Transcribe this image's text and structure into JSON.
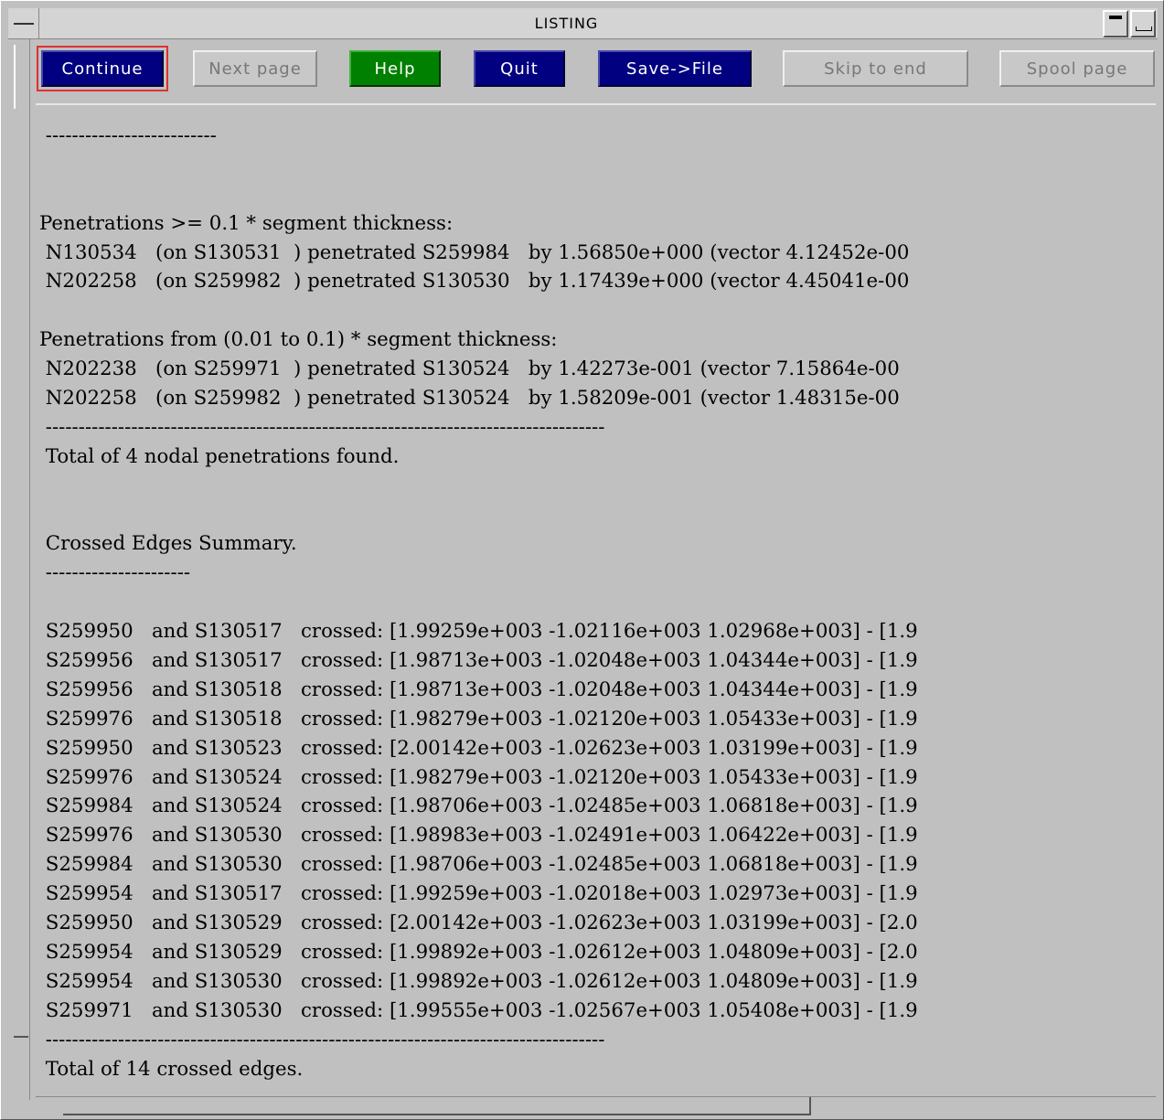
{
  "window": {
    "title": "LISTING"
  },
  "toolbar": {
    "buttons": [
      {
        "label": "Continue",
        "style": "navy",
        "enabled": true,
        "focused": true
      },
      {
        "label": "Next page",
        "style": "disabled",
        "enabled": false
      },
      {
        "label": "Help",
        "style": "green",
        "enabled": true
      },
      {
        "label": "Quit",
        "style": "navy",
        "enabled": true
      },
      {
        "label": "Save->File",
        "style": "navy",
        "enabled": true
      },
      {
        "label": "Skip to end",
        "style": "disabled",
        "enabled": false
      },
      {
        "label": "Spool page",
        "style": "disabled",
        "enabled": false
      }
    ]
  },
  "listing": {
    "lines": [
      " --------------------------",
      "",
      "",
      "Penetrations >= 0.1 * segment thickness:",
      " N130534   (on S130531  ) penetrated S259984   by 1.56850e+000 (vector 4.12452e-00",
      " N202258   (on S259982  ) penetrated S130530   by 1.17439e+000 (vector 4.45041e-00",
      "",
      "Penetrations from (0.01 to 0.1) * segment thickness:",
      " N202238   (on S259971  ) penetrated S130524   by 1.42273e-001 (vector 7.15864e-00",
      " N202258   (on S259982  ) penetrated S130524   by 1.58209e-001 (vector 1.48315e-00",
      " -------------------------------------------------------------------------------------",
      " Total of 4 nodal penetrations found.",
      "",
      "",
      " Crossed Edges Summary.",
      " ----------------------",
      "",
      " S259950   and S130517   crossed: [1.99259e+003 -1.02116e+003 1.02968e+003] - [1.9",
      " S259956   and S130517   crossed: [1.98713e+003 -1.02048e+003 1.04344e+003] - [1.9",
      " S259956   and S130518   crossed: [1.98713e+003 -1.02048e+003 1.04344e+003] - [1.9",
      " S259976   and S130518   crossed: [1.98279e+003 -1.02120e+003 1.05433e+003] - [1.9",
      " S259950   and S130523   crossed: [2.00142e+003 -1.02623e+003 1.03199e+003] - [1.9",
      " S259976   and S130524   crossed: [1.98279e+003 -1.02120e+003 1.05433e+003] - [1.9",
      " S259984   and S130524   crossed: [1.98706e+003 -1.02485e+003 1.06818e+003] - [1.9",
      " S259976   and S130530   crossed: [1.98983e+003 -1.02491e+003 1.06422e+003] - [1.9",
      " S259984   and S130530   crossed: [1.98706e+003 -1.02485e+003 1.06818e+003] - [1.9",
      " S259954   and S130517   crossed: [1.99259e+003 -1.02018e+003 1.02973e+003] - [1.9",
      " S259950   and S130529   crossed: [2.00142e+003 -1.02623e+003 1.03199e+003] - [2.0",
      " S259954   and S130529   crossed: [1.99892e+003 -1.02612e+003 1.04809e+003] - [2.0",
      " S259954   and S130530   crossed: [1.99892e+003 -1.02612e+003 1.04809e+003] - [1.9",
      " S259971   and S130530   crossed: [1.99555e+003 -1.02567e+003 1.05408e+003] - [1.9",
      " -------------------------------------------------------------------------------------",
      " Total of 14 crossed edges."
    ]
  },
  "colors": {
    "background": "#c0c0c0",
    "button_navy": "#000080",
    "button_green": "#008000",
    "focus_outline": "#e03030"
  },
  "icons": {
    "window_menu": "window-menu-icon",
    "minimize": "minimize-icon",
    "maximize": "maximize-icon"
  }
}
